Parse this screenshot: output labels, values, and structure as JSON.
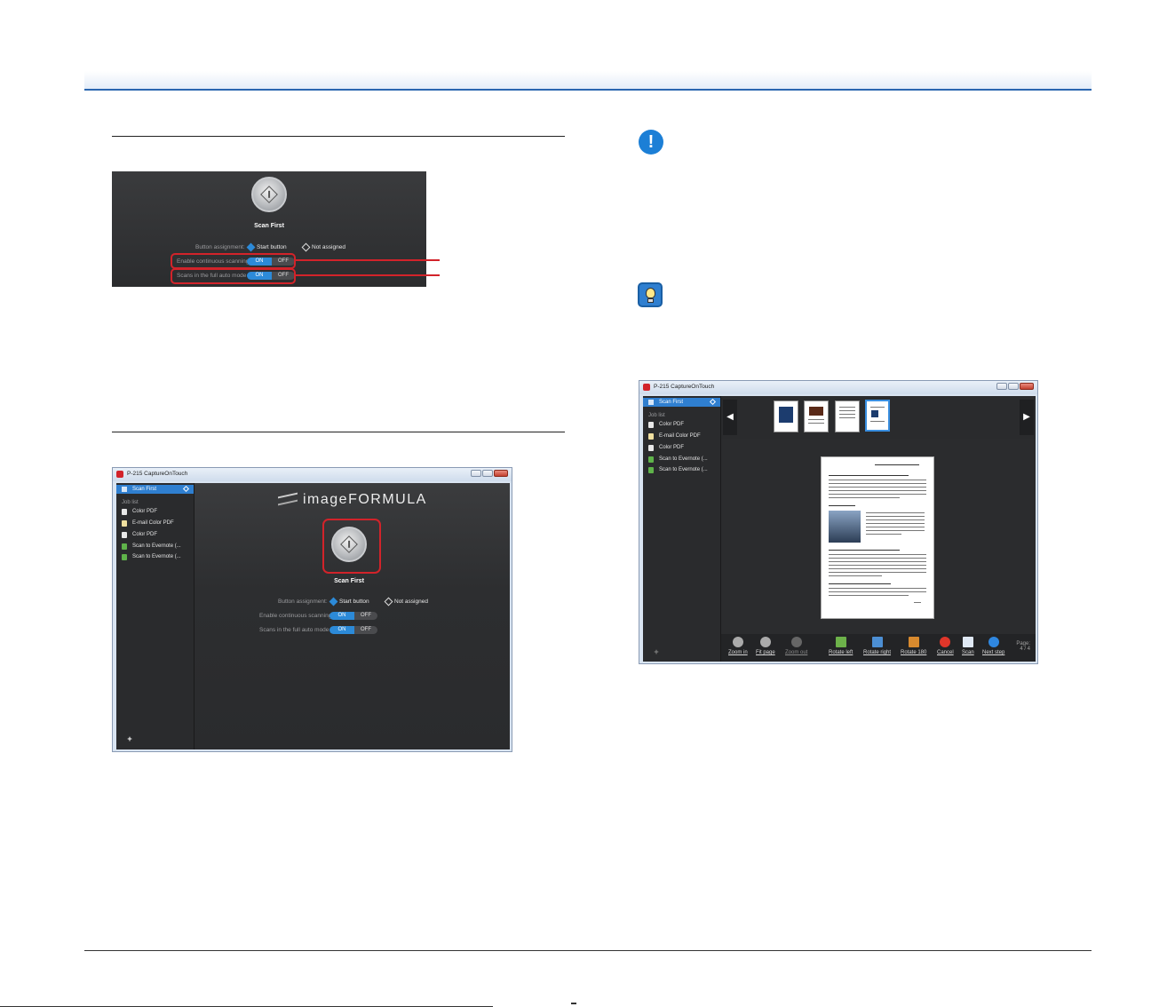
{
  "figure1": {
    "job_name": "Scan First",
    "button_assignment_label": "Button assignment:",
    "start_button": "Start button",
    "not_assigned": "Not assigned",
    "continuous_label": "Enable continuous scanning",
    "auto_mode_label": "Scans in the full auto mode",
    "on": "ON",
    "off": "OFF"
  },
  "figure2": {
    "window_title": "P-215 CaptureOnTouch",
    "selected_job": "Scan First",
    "job_list_heading": "Job list",
    "jobs": [
      "Color PDF",
      "E-mail Color PDF",
      "Color PDF",
      "Scan to Evernote (...",
      "Scan to Evernote (..."
    ],
    "logo_text": "imageFORMULA",
    "job_name": "Scan First",
    "button_assignment_label": "Button assignment:",
    "start_button": "Start button",
    "not_assigned": "Not assigned",
    "continuous_label": "Enable continuous scanning",
    "auto_mode_label": "Scans in the full auto mode",
    "on": "ON",
    "off": "OFF",
    "add_symbol": "+"
  },
  "figure3": {
    "window_title": "P-215 CaptureOnTouch",
    "selected_job": "Scan First",
    "job_list_heading": "Job list",
    "jobs": [
      "Color PDF",
      "E-mail Color PDF",
      "Color PDF",
      "Scan to Evernote (...",
      "Scan to Evernote (..."
    ],
    "add_symbol": "+",
    "toolbar": {
      "zoom_in": "Zoom in",
      "fit_page": "Fit page",
      "zoom_out": "Zoom out",
      "rotate_left": "Rotate left",
      "rotate_right": "Rotate right",
      "rotate_180": "Rotate 180",
      "cancel": "Cancel",
      "scan": "Scan",
      "next_step": "Next step"
    },
    "page_label": "Page:",
    "page_value": "4 / 4",
    "thumbnail_count": 4,
    "selected_thumbnail": 4
  },
  "icons": {
    "important": "exclamation-icon",
    "hint": "lightbulb-icon"
  },
  "colors": {
    "header_rule": "#2a66b0",
    "callout_red": "#d2232a",
    "toggle_on": "#2c8ad8",
    "selection_blue": "#2f7fd0"
  }
}
